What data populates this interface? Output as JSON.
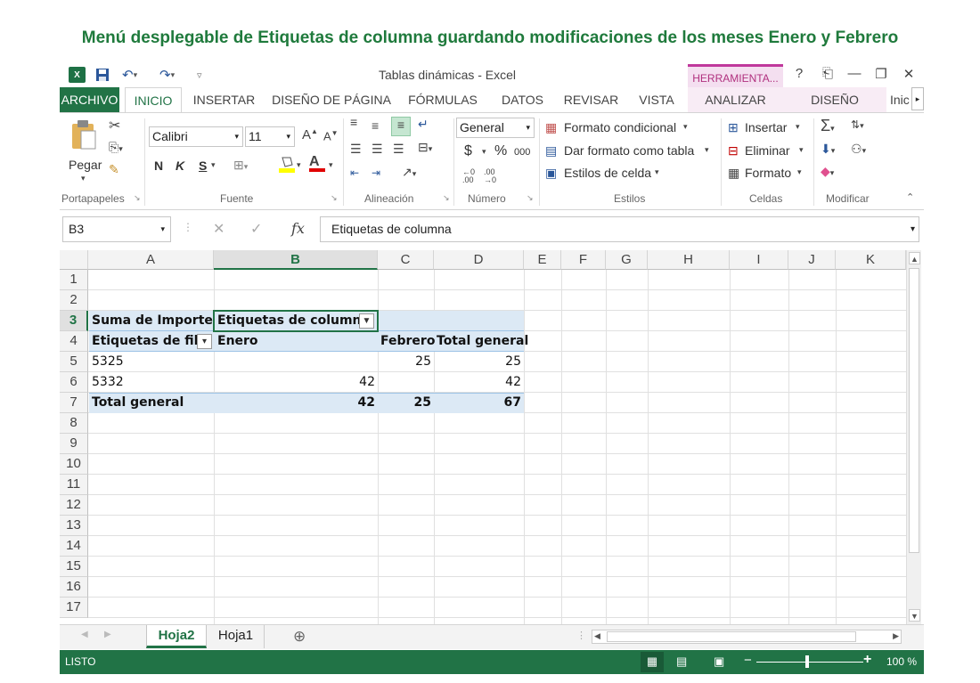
{
  "caption": "Menú desplegable de Etiquetas de columna guardando modificaciones de los meses Enero y Febrero",
  "window": {
    "title": "Tablas dinámicas - Excel",
    "context_tab": "HERRAMIENTA...",
    "help": "?"
  },
  "ribbon_tabs": [
    "ARCHIVO",
    "INICIO",
    "INSERTAR",
    "DISEÑO DE PÁGINA",
    "FÓRMULAS",
    "DATOS",
    "REVISAR",
    "VISTA",
    "ANALIZAR",
    "DISEÑO",
    "Inic"
  ],
  "ribbon": {
    "paste_label": "Pegar",
    "font_name": "Calibri",
    "font_size": "11",
    "bold": "N",
    "italic": "K",
    "underline": "S",
    "number_format": "General",
    "currency": "$",
    "percent": "%",
    "thousands": "000",
    "cond_format": "Formato condicional",
    "format_table": "Dar formato como tabla",
    "cell_styles": "Estilos de celda",
    "insert": "Insertar",
    "delete": "Eliminar",
    "format": "Formato",
    "groups": {
      "clipboard": "Portapapeles",
      "font": "Fuente",
      "alignment": "Alineación",
      "number": "Número",
      "styles": "Estilos",
      "cells": "Celdas",
      "modify": "Modificar"
    }
  },
  "formula_bar": {
    "name_box": "B3",
    "fx": "fx",
    "content": "Etiquetas de columna"
  },
  "columns": [
    "A",
    "B",
    "C",
    "D",
    "E",
    "F",
    "G",
    "H",
    "I",
    "J",
    "K"
  ],
  "rows": [
    "1",
    "2",
    "3",
    "4",
    "5",
    "6",
    "7",
    "8",
    "9",
    "10",
    "11",
    "12",
    "13",
    "14",
    "15",
    "16",
    "17"
  ],
  "pivot": {
    "a3": "Suma de Importe",
    "b3": "Etiquetas de columna",
    "a4": "Etiquetas de fila",
    "b4": "Enero",
    "c4": "Febrero",
    "d4": "Total general",
    "a5": "5325",
    "c5": "25",
    "d5": "25",
    "a6": "5332",
    "b6": "42",
    "d6": "42",
    "a7": "Total general",
    "b7": "42",
    "c7": "25",
    "d7": "67"
  },
  "sheets": [
    "Hoja2",
    "Hoja1"
  ],
  "status": {
    "mode": "LISTO",
    "zoom": "100 %"
  }
}
